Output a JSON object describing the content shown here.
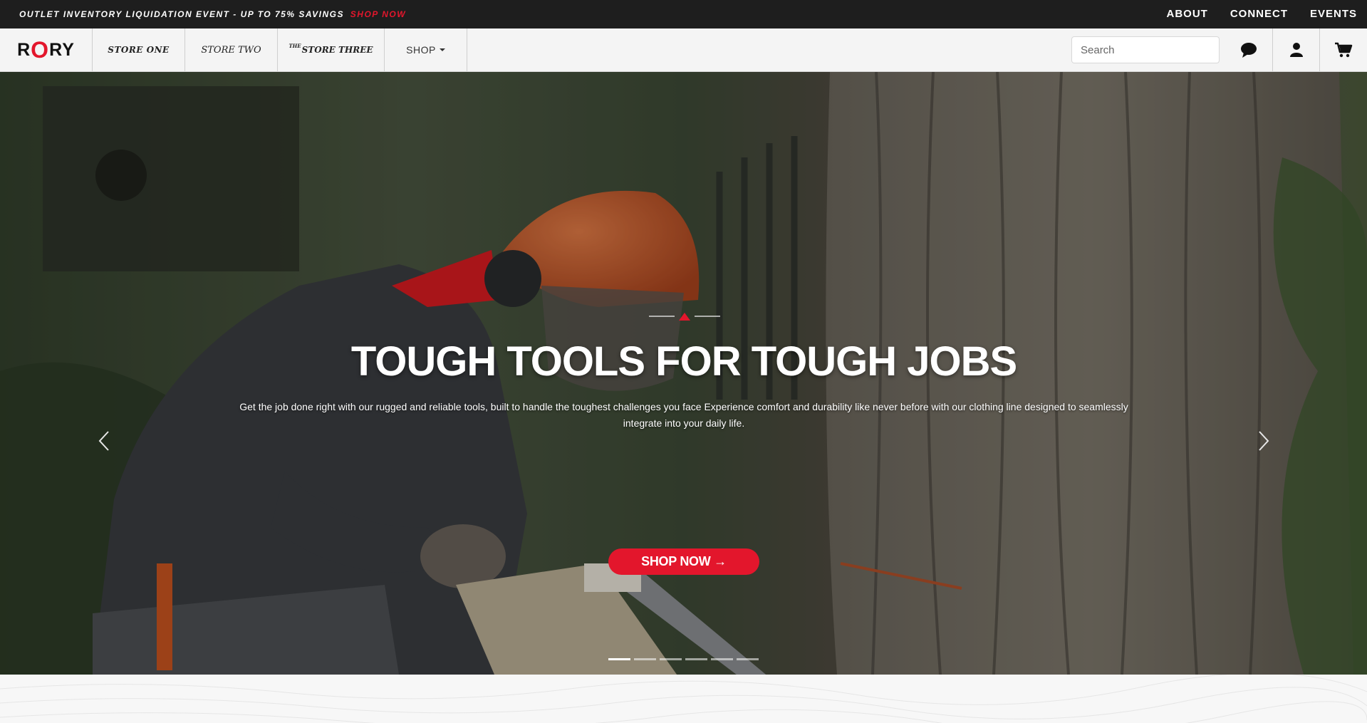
{
  "announcement": {
    "text": "OUTLET INVENTORY LIQUIDATION EVENT - UP TO 75% SAVINGS",
    "link": "SHOP NOW"
  },
  "top_links": [
    "ABOUT",
    "CONNECT",
    "EVENTS"
  ],
  "nav": {
    "logo_pre": "R",
    "logo_o": "O",
    "logo_post": "RY",
    "store_one": "STORE ONE",
    "store_two": "STORE TWO",
    "store_three_prefix": "THE",
    "store_three": "STORE THREE",
    "shop": "SHOP",
    "search_placeholder": "Search",
    "icons": [
      "chat-icon",
      "user-icon",
      "cart-icon"
    ]
  },
  "hero": {
    "title": "TOUGH TOOLS FOR TOUGH JOBS",
    "description": "Get the job done right with our rugged and reliable tools, built to handle the toughest challenges you face Experience comfort and durability like never before with our clothing line designed to seamlessly integrate into your daily life.",
    "cta": "SHOP NOW →",
    "slide_count": 6,
    "active_slide": 1
  },
  "colors": {
    "brand_red": "#e3162c",
    "announce_bg": "#1e1e1e",
    "nav_bg": "#f4f4f4"
  }
}
